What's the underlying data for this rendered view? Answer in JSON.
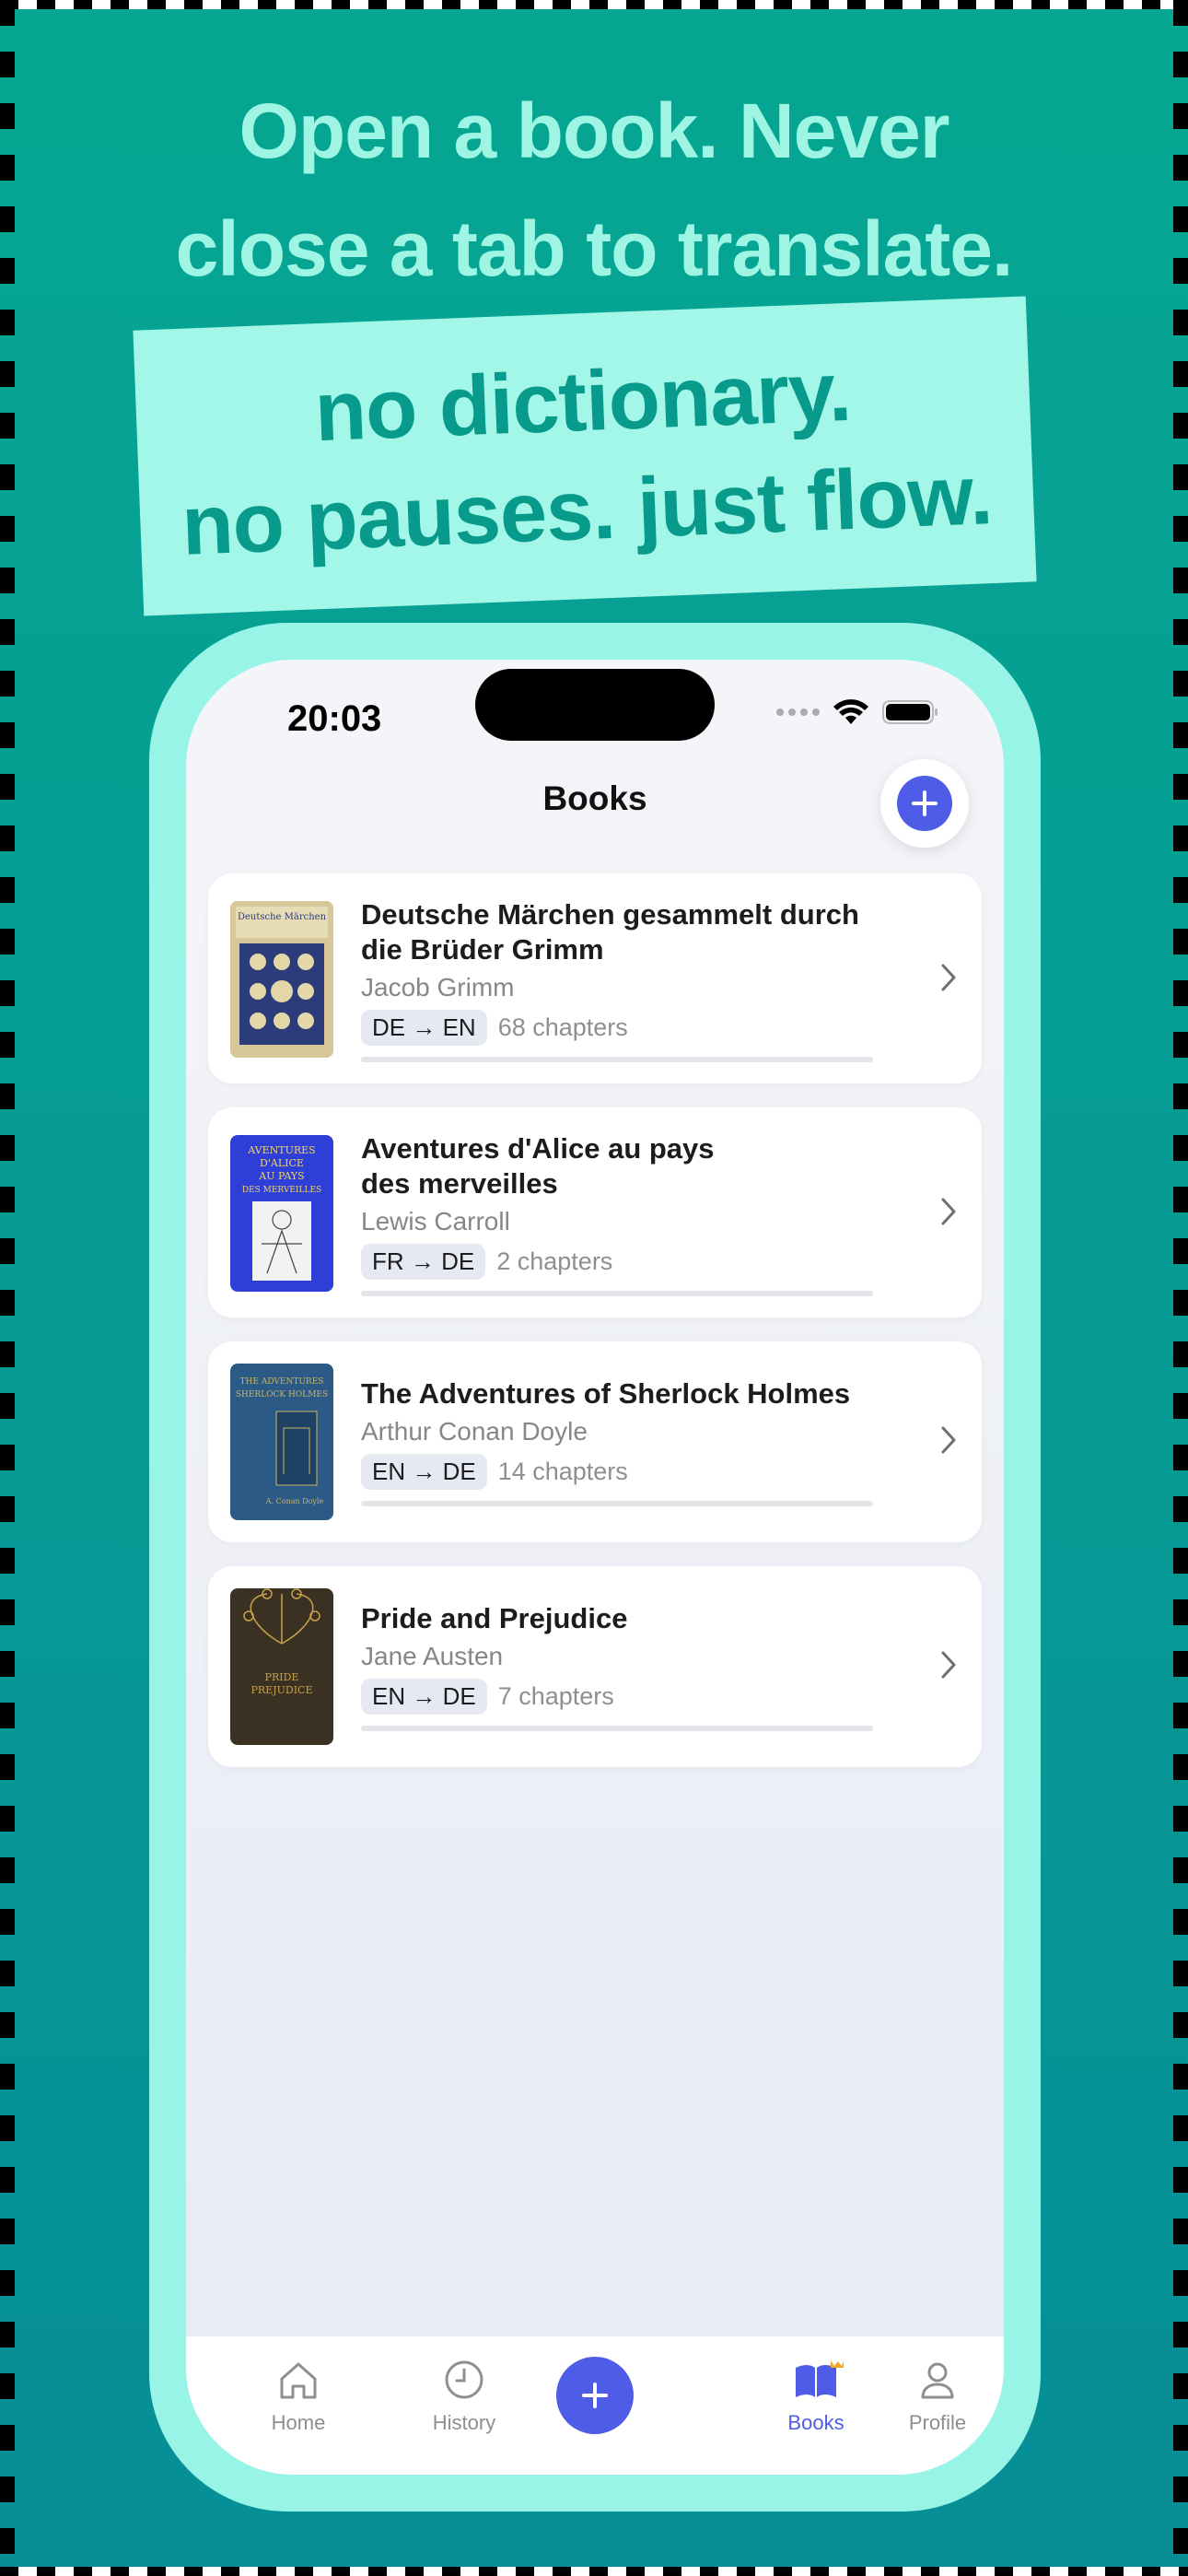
{
  "promo": {
    "headline_line1": "Open a book. Never",
    "headline_line2": "close a tab to translate.",
    "sticker_line1": "no dictionary.",
    "sticker_line2": "no pauses. just flow."
  },
  "status_bar": {
    "time": "20:03"
  },
  "header": {
    "title": "Books",
    "add_icon": "plus-icon"
  },
  "books": [
    {
      "title": "Deutsche Märchen gesammelt durch die Brüder Grimm",
      "author": "Jacob Grimm",
      "lang": "DE → EN",
      "chapters": "68 chapters",
      "progress": 0
    },
    {
      "title": "Aventures d'Alice au pays des merveilles",
      "author": "Lewis Carroll",
      "lang": "FR → DE",
      "chapters": "2 chapters",
      "progress": 0
    },
    {
      "title": "The Adventures of Sherlock Holmes",
      "author": "Arthur Conan Doyle",
      "lang": "EN → DE",
      "chapters": "14 chapters",
      "progress": 0
    },
    {
      "title": "Pride and Prejudice",
      "author": "Jane Austen",
      "lang": "EN → DE",
      "chapters": "7 chapters",
      "progress": 0
    }
  ],
  "tab_bar": {
    "home": "Home",
    "history": "History",
    "books": "Books",
    "profile": "Profile"
  },
  "colors": {
    "accent": "#4f5ce8",
    "background": "#06a692",
    "headline": "#9ff5e3",
    "sticker": "#a3f7e8"
  }
}
